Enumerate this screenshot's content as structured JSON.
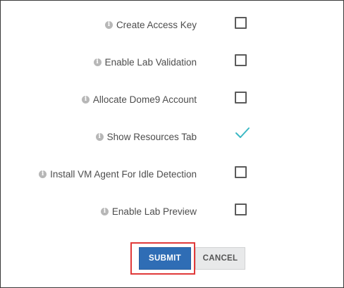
{
  "info_icon_glyph": "i",
  "options": [
    {
      "label": "Create Access Key",
      "checked": false
    },
    {
      "label": "Enable Lab Validation",
      "checked": false
    },
    {
      "label": "Allocate Dome9 Account",
      "checked": false
    },
    {
      "label": "Show Resources Tab",
      "checked": true
    },
    {
      "label": "Install VM Agent For Idle Detection",
      "checked": false
    },
    {
      "label": "Enable Lab Preview",
      "checked": false
    }
  ],
  "buttons": {
    "submit_label": "SUBMIT",
    "cancel_label": "CANCEL"
  },
  "colors": {
    "submit_bg": "#2f6db5",
    "checkmark": "#3bb8c4",
    "highlight_border": "#e03a3a"
  }
}
